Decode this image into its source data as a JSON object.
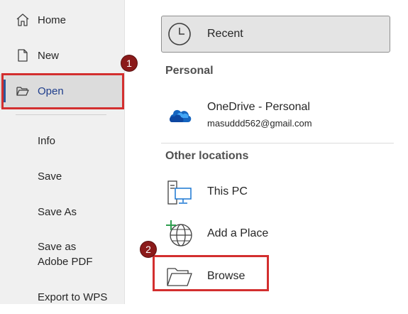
{
  "sidebar": {
    "items": [
      {
        "label": "Home",
        "icon": "home-icon"
      },
      {
        "label": "New",
        "icon": "new-document-icon"
      },
      {
        "label": "Open",
        "icon": "open-folder-icon",
        "active": true
      },
      {
        "label": "Info"
      },
      {
        "label": "Save"
      },
      {
        "label": "Save As"
      },
      {
        "label_line1": "Save as",
        "label_line2": "Adobe PDF"
      },
      {
        "label": "Export to WPS"
      }
    ]
  },
  "main": {
    "recent": {
      "label": "Recent",
      "icon": "clock-icon"
    },
    "personal": {
      "title": "Personal",
      "onedrive": {
        "label": "OneDrive - Personal",
        "email": "masuddd562@gmail.com",
        "icon": "onedrive-cloud-icon"
      }
    },
    "other_locations": {
      "title": "Other locations",
      "this_pc": {
        "label": "This PC",
        "icon": "computer-icon"
      },
      "add_place": {
        "label": "Add a Place",
        "icon": "globe-add-icon"
      },
      "browse": {
        "label": "Browse",
        "icon": "browse-folder-icon"
      }
    }
  },
  "annotations": {
    "step1": "1",
    "step2": "2",
    "color": "#d32f2f"
  }
}
